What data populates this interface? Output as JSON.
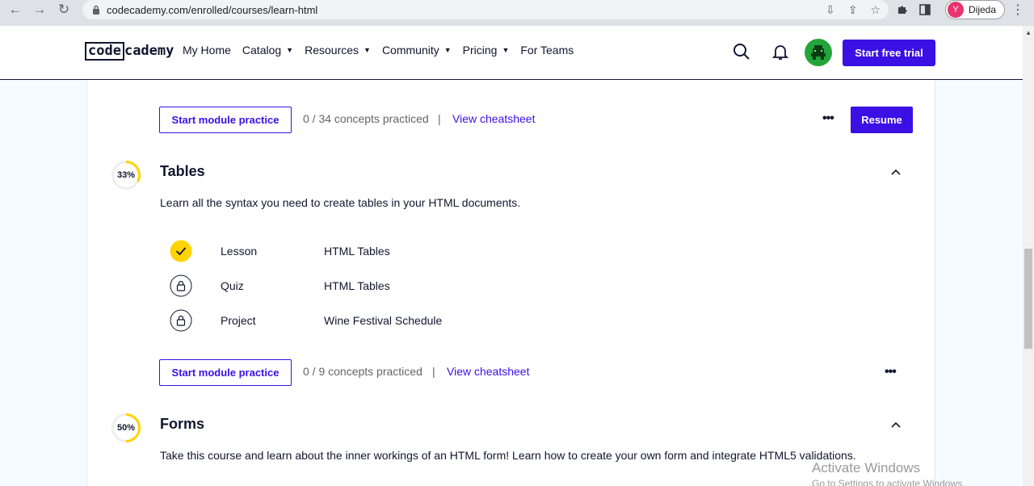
{
  "browser": {
    "url": "codecademy.com/enrolled/courses/learn-html",
    "profile_initial": "Y",
    "profile_name": "Dijeda"
  },
  "header": {
    "logo_code": "code",
    "logo_rest": "cademy",
    "nav": [
      {
        "label": "My Home",
        "has_caret": false
      },
      {
        "label": "Catalog",
        "has_caret": true
      },
      {
        "label": "Resources",
        "has_caret": true
      },
      {
        "label": "Community",
        "has_caret": true
      },
      {
        "label": "Pricing",
        "has_caret": true
      },
      {
        "label": "For Teams",
        "has_caret": false
      }
    ],
    "trial_label": "Start free trial"
  },
  "top_practice": {
    "button_label": "Start module practice",
    "concepts": "0 / 34 concepts practiced",
    "separator": "|",
    "cheatsheet": "View cheatsheet",
    "more": "•••",
    "resume_label": "Resume"
  },
  "modules": [
    {
      "percent_label": "33%",
      "percent": 33,
      "title": "Tables",
      "description": "Learn all the syntax you need to create tables in your HTML documents.",
      "items": [
        {
          "type": "Lesson",
          "name": "HTML Tables",
          "status": "complete"
        },
        {
          "type": "Quiz",
          "name": "HTML Tables",
          "status": "locked"
        },
        {
          "type": "Project",
          "name": "Wine Festival Schedule",
          "status": "locked"
        }
      ],
      "practice": {
        "button_label": "Start module practice",
        "concepts": "0 / 9 concepts practiced",
        "separator": "|",
        "cheatsheet": "View cheatsheet",
        "more": "•••"
      }
    },
    {
      "percent_label": "50%",
      "percent": 50,
      "title": "Forms",
      "description": "Take this course and learn about the inner workings of an HTML form! Learn how to create your own form and integrate HTML5 validations."
    }
  ],
  "colors": {
    "accent": "#3a10e5",
    "progress": "#ffd300",
    "navy": "#10162f"
  },
  "watermark": {
    "title": "Activate Windows",
    "subtitle": "Go to Settings to activate Windows."
  }
}
